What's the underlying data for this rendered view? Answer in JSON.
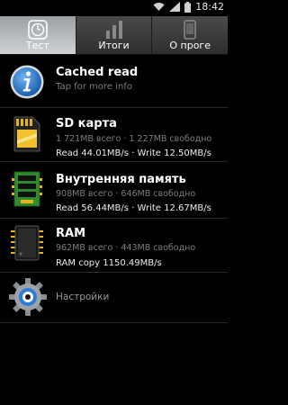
{
  "status_bar": {
    "time": "18:42"
  },
  "tabs": [
    {
      "label": "Тест",
      "icon": "gauge-icon",
      "active": true
    },
    {
      "label": "Итоги",
      "icon": "bar-chart-icon",
      "active": false
    },
    {
      "label": "О проге",
      "icon": "phone-icon",
      "active": false
    }
  ],
  "items": {
    "cached": {
      "title": "Cached read",
      "subtitle": "Tap for more info",
      "icon": "info-icon"
    },
    "sd": {
      "title": "SD карта",
      "capacity": "1 721MB всего · 1 227MB свободно",
      "speed": "Read 44.01MB/s · Write 12.50MB/s",
      "icon": "sd-card-icon"
    },
    "internal": {
      "title": "Внутренняя память",
      "capacity": "908MB всего · 646MB свободно",
      "speed": "Read 56.44MB/s · Write 12.67MB/s",
      "icon": "memory-stick-icon"
    },
    "ram": {
      "title": "RAM",
      "capacity": "962MB всего · 443MB свободно",
      "speed": "RAM copy 1150.49MB/s",
      "icon": "chip-icon"
    },
    "settings": {
      "label": "Настройки",
      "icon": "gear-icon"
    }
  },
  "colors": {
    "tab_active": "#c0c4c7",
    "accent_blue": "#2a7fd4",
    "sd_gold": "#e8b21a",
    "mem_green": "#2f8a2f"
  }
}
